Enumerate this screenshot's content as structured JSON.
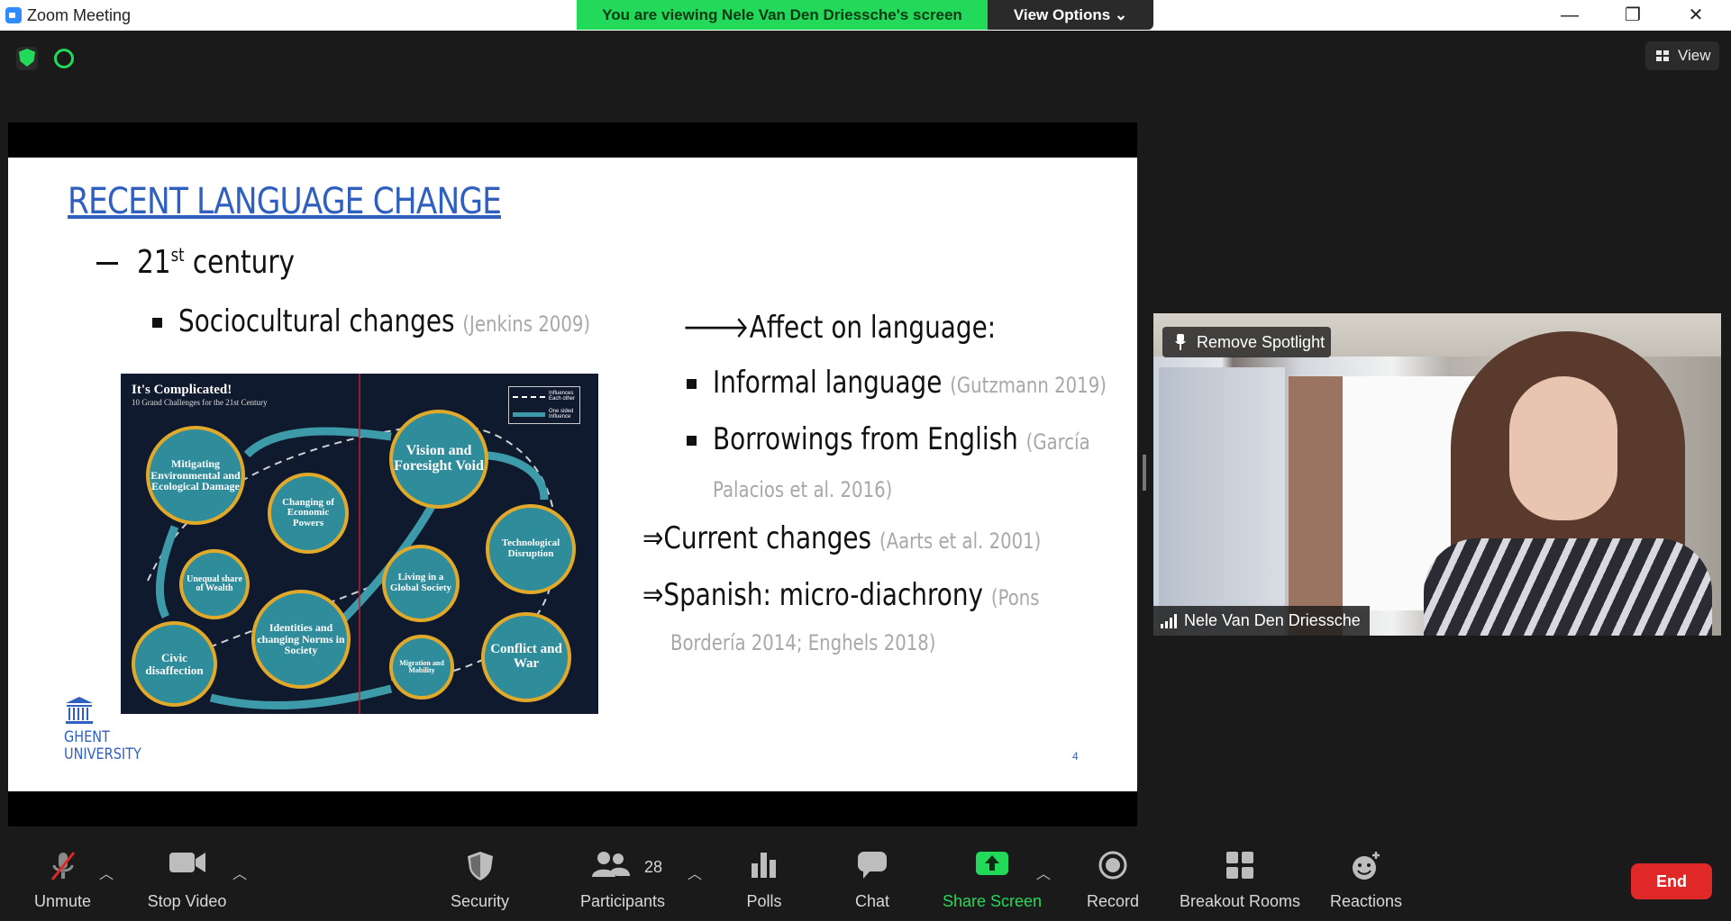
{
  "window": {
    "title": "Zoom Meeting",
    "controls": [
      "—",
      "❐",
      "✕"
    ]
  },
  "banner": {
    "viewing_text": "You are viewing Nele Van Den Driessche's screen",
    "view_options": "View Options ⌄"
  },
  "view_button": {
    "label": "View"
  },
  "slide": {
    "heading": "RECENT LANGUAGE CHANGE",
    "level1": {
      "base": "21",
      "sup": "st",
      "rest": " century"
    },
    "level2": {
      "text": "Sociocultural changes ",
      "cite": "(Jenkins 2009)"
    },
    "affect": {
      "arrow": "🡒",
      "text": "Affect on language:"
    },
    "bullets": [
      {
        "text": "Informal language ",
        "cite": "(Gutzmann 2019)"
      },
      {
        "text": "Borrowings from English ",
        "cite": "(García",
        "cite2": "Palacios et al. 2016)"
      }
    ],
    "implications": [
      {
        "arrow": "⇒",
        "text": "Current changes ",
        "cite": "(Aarts et al. 2001)"
      },
      {
        "arrow": "⇒",
        "text": "Spanish: micro-diachrony ",
        "cite": "(Pons",
        "cite2": "Bordería 2014; Enghels 2018)"
      }
    ],
    "logo": {
      "line1": "GHENT",
      "line2": "UNIVERSITY"
    },
    "page_number": "4",
    "infographic": {
      "title": "It's Complicated!",
      "subtitle": "10 Grand Challenges for the 21st Century",
      "legend": [
        "Influences Each other",
        "One sided Influence"
      ],
      "circles": [
        "Mitigating Environmental and Ecological Damage",
        "Changing of Economic Powers",
        "Vision and Foresight Void",
        "Technological Disruption",
        "Unequal share of Wealth",
        "Living in a Global Society",
        "Identities and changing Norms in Society",
        "Civic disaffection",
        "Migration and Mobility",
        "Conflict and War"
      ]
    }
  },
  "participant_video": {
    "spotlight_button": "Remove Spotlight",
    "name": "Nele Van Den Driessche"
  },
  "toolbar": {
    "unmute": "Unmute",
    "stop_video": "Stop Video",
    "security": "Security",
    "participants": "Participants",
    "participants_count": "28",
    "polls": "Polls",
    "chat": "Chat",
    "share_screen": "Share Screen",
    "record": "Record",
    "breakout": "Breakout Rooms",
    "reactions": "Reactions",
    "end": "End"
  },
  "colors": {
    "accent_green": "#23d959",
    "slide_blue": "#2f5fbf",
    "end_red": "#e02828"
  }
}
